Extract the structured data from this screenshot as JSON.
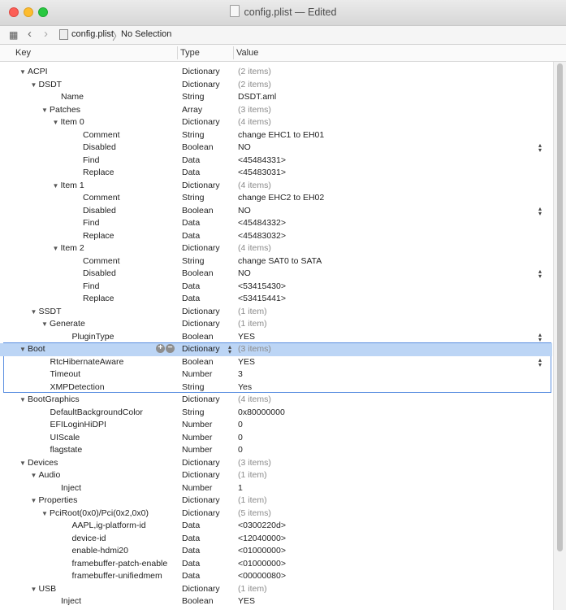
{
  "window": {
    "title": "config.plist — Edited"
  },
  "toolbar": {
    "file": "config.plist",
    "separator": "〉",
    "selection": "No Selection"
  },
  "columns": {
    "key": "Key",
    "type": "Type",
    "value": "Value"
  },
  "icons": {
    "grid": "grid-view-icon",
    "back": "chevron-left-icon",
    "forward": "chevron-right-icon",
    "doc": "document-icon",
    "stepper": "up-down-stepper-icon",
    "add": "add-row-icon",
    "remove": "remove-row-icon"
  },
  "colors": {
    "selected_row": "#bcd5f5",
    "selection_border": "#5b8fe0",
    "close": "#fc5f57",
    "minimize": "#fdbc2e",
    "maximize": "#28c840"
  },
  "rows": [
    {
      "key": "ACPI",
      "type": "Dictionary",
      "value": "(2 items)",
      "depth": 0,
      "expanded": true,
      "muted": true
    },
    {
      "key": "DSDT",
      "type": "Dictionary",
      "value": "(2 items)",
      "depth": 1,
      "expanded": true,
      "muted": true
    },
    {
      "key": "Name",
      "type": "String",
      "value": "DSDT.aml",
      "depth": 2
    },
    {
      "key": "Patches",
      "type": "Array",
      "value": "(3 items)",
      "depth": 2,
      "expanded": true,
      "muted": true
    },
    {
      "key": "Item 0",
      "type": "Dictionary",
      "value": "(4 items)",
      "depth": 3,
      "expanded": true,
      "muted": true
    },
    {
      "key": "Comment",
      "type": "String",
      "value": "change EHC1 to EH01",
      "depth": 4
    },
    {
      "key": "Disabled",
      "type": "Boolean",
      "value": "NO",
      "depth": 4,
      "stepper": true
    },
    {
      "key": "Find",
      "type": "Data",
      "value": "<45484331>",
      "depth": 4
    },
    {
      "key": "Replace",
      "type": "Data",
      "value": "<45483031>",
      "depth": 4
    },
    {
      "key": "Item 1",
      "type": "Dictionary",
      "value": "(4 items)",
      "depth": 3,
      "expanded": true,
      "muted": true
    },
    {
      "key": "Comment",
      "type": "String",
      "value": "change EHC2 to EH02",
      "depth": 4
    },
    {
      "key": "Disabled",
      "type": "Boolean",
      "value": "NO",
      "depth": 4,
      "stepper": true
    },
    {
      "key": "Find",
      "type": "Data",
      "value": "<45484332>",
      "depth": 4
    },
    {
      "key": "Replace",
      "type": "Data",
      "value": "<45483032>",
      "depth": 4
    },
    {
      "key": "Item 2",
      "type": "Dictionary",
      "value": "(4 items)",
      "depth": 3,
      "expanded": true,
      "muted": true
    },
    {
      "key": "Comment",
      "type": "String",
      "value": "change SAT0 to SATA",
      "depth": 4
    },
    {
      "key": "Disabled",
      "type": "Boolean",
      "value": "NO",
      "depth": 4,
      "stepper": true
    },
    {
      "key": "Find",
      "type": "Data",
      "value": "<53415430>",
      "depth": 4
    },
    {
      "key": "Replace",
      "type": "Data",
      "value": "<53415441>",
      "depth": 4
    },
    {
      "key": "SSDT",
      "type": "Dictionary",
      "value": "(1 item)",
      "depth": 1,
      "expanded": true,
      "muted": true
    },
    {
      "key": "Generate",
      "type": "Dictionary",
      "value": "(1 item)",
      "depth": 2,
      "expanded": true,
      "muted": true
    },
    {
      "key": "PluginType",
      "type": "Boolean",
      "value": "YES",
      "depth": 3,
      "stepper": true
    },
    {
      "key": "Boot",
      "type": "Dictionary",
      "value": "(3 items)",
      "depth": 0,
      "expanded": true,
      "muted": true,
      "selected": true
    },
    {
      "key": "RtcHibernateAware",
      "type": "Boolean",
      "value": "YES",
      "depth": 1,
      "stepper": true
    },
    {
      "key": "Timeout",
      "type": "Number",
      "value": "3",
      "depth": 1
    },
    {
      "key": "XMPDetection",
      "type": "String",
      "value": "Yes",
      "depth": 1
    },
    {
      "key": "BootGraphics",
      "type": "Dictionary",
      "value": "(4 items)",
      "depth": 0,
      "expanded": true,
      "muted": true
    },
    {
      "key": "DefaultBackgroundColor",
      "type": "String",
      "value": "0x80000000",
      "depth": 1
    },
    {
      "key": "EFILoginHiDPI",
      "type": "Number",
      "value": "0",
      "depth": 1
    },
    {
      "key": "UIScale",
      "type": "Number",
      "value": "0",
      "depth": 1
    },
    {
      "key": "flagstate",
      "type": "Number",
      "value": "0",
      "depth": 1
    },
    {
      "key": "Devices",
      "type": "Dictionary",
      "value": "(3 items)",
      "depth": 0,
      "expanded": true,
      "muted": true
    },
    {
      "key": "Audio",
      "type": "Dictionary",
      "value": "(1 item)",
      "depth": 1,
      "expanded": true,
      "muted": true
    },
    {
      "key": "Inject",
      "type": "Number",
      "value": "1",
      "depth": 2
    },
    {
      "key": "Properties",
      "type": "Dictionary",
      "value": "(1 item)",
      "depth": 1,
      "expanded": true,
      "muted": true
    },
    {
      "key": "PciRoot(0x0)/Pci(0x2,0x0)",
      "type": "Dictionary",
      "value": "(5 items)",
      "depth": 2,
      "expanded": true,
      "muted": true
    },
    {
      "key": "AAPL,ig-platform-id",
      "type": "Data",
      "value": "<0300220d>",
      "depth": 3
    },
    {
      "key": "device-id",
      "type": "Data",
      "value": "<12040000>",
      "depth": 3
    },
    {
      "key": "enable-hdmi20",
      "type": "Data",
      "value": "<01000000>",
      "depth": 3
    },
    {
      "key": "framebuffer-patch-enable",
      "type": "Data",
      "value": "<01000000>",
      "depth": 3
    },
    {
      "key": "framebuffer-unifiedmem",
      "type": "Data",
      "value": "<00000080>",
      "depth": 3
    },
    {
      "key": "USB",
      "type": "Dictionary",
      "value": "(1 item)",
      "depth": 1,
      "expanded": true,
      "muted": true
    },
    {
      "key": "Inject",
      "type": "Boolean",
      "value": "YES",
      "depth": 2
    }
  ]
}
